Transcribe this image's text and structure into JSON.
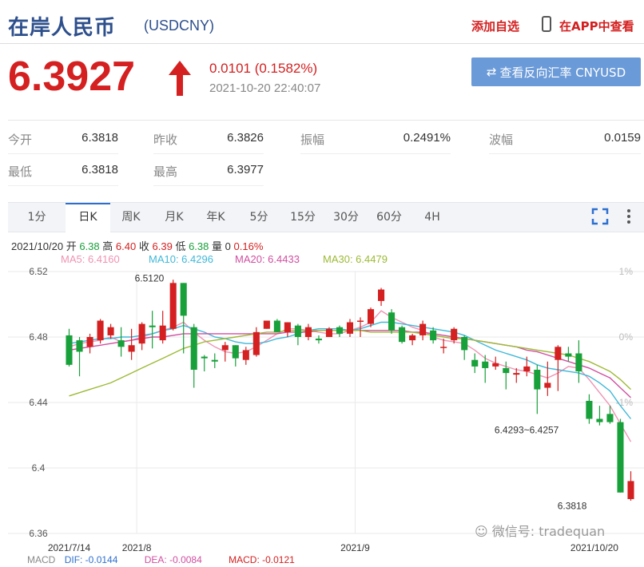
{
  "header": {
    "title": "在岸人民币",
    "code": "(USDCNY)",
    "add_watch": "添加自选",
    "app_view": "在APP中查看"
  },
  "quote": {
    "price": "6.3927",
    "change": "0.0101 (0.1582%)",
    "datetime": "2021-10-20 22:40:07",
    "reverse_button": "查看反向汇率 CNYUSD",
    "direction": "up",
    "up_color": "#d42020",
    "down_color": "#18a03a"
  },
  "stats": [
    {
      "label": "今开",
      "value": "6.3818"
    },
    {
      "label": "昨收",
      "value": "6.3826"
    },
    {
      "label": "振幅",
      "value": "0.2491%"
    },
    {
      "label": "波幅",
      "value": "0.0159"
    },
    {
      "label": "最低",
      "value": "6.3818"
    },
    {
      "label": "最高",
      "value": "6.3977"
    }
  ],
  "tabs": [
    "1分",
    "日K",
    "周K",
    "月K",
    "年K",
    "5分",
    "15分",
    "30分",
    "60分",
    "4H"
  ],
  "active_tab": "日K",
  "ohlc_line": {
    "date": "2021/10/20",
    "open_label": "开",
    "open": "6.38",
    "high_label": "高",
    "high": "6.40",
    "close_label": "收",
    "close": "6.39",
    "low_label": "低",
    "low": "6.38",
    "vol_label": "量",
    "vol": "0",
    "pct": "0.16%"
  },
  "ma_line": [
    {
      "text": "MA5: 6.4160",
      "color": "#ef93b4"
    },
    {
      "text": "MA10: 6.4296",
      "color": "#3fb8d8"
    },
    {
      "text": "MA20: 6.4433",
      "color": "#d04fa0"
    },
    {
      "text": "MA30: 6.4479",
      "color": "#9cba35"
    }
  ],
  "macd_line": [
    {
      "text": "MACD",
      "color": "#888888"
    },
    {
      "text": "DIF: -0.0144",
      "color": "#3070d0"
    },
    {
      "text": "DEA: -0.0084",
      "color": "#d04fa0"
    },
    {
      "text": "MACD: -0.0121",
      "color": "#d42020"
    }
  ],
  "watermarks": {
    "wechat": "微信号: tradequan"
  },
  "chart_data": {
    "type": "candlestick",
    "y_ticks": [
      "6.52",
      "6.48",
      "6.44",
      "6.4",
      "6.36"
    ],
    "y_tick_values": [
      6.52,
      6.48,
      6.44,
      6.4,
      6.36
    ],
    "pct_ticks": [
      "1%",
      "0%",
      "-1%"
    ],
    "ylim": [
      6.36,
      6.52
    ],
    "x_labels": [
      "2021/7/14",
      "2021/8",
      "2021/9",
      "2021/10/20"
    ],
    "x_label_index": [
      0,
      6.5,
      27.5,
      50.5
    ],
    "annotations": [
      {
        "text": "6.5120",
        "index": 6,
        "value": 6.512
      },
      {
        "text": "6.4293~6.4257",
        "index": 46,
        "value": 6.428
      },
      {
        "text": "6.3818",
        "index": 49,
        "value": 6.3818
      }
    ],
    "candles": [
      [
        6.481,
        6.463,
        6.485,
        6.462
      ],
      [
        6.478,
        6.471,
        6.48,
        6.456
      ],
      [
        6.474,
        6.48,
        6.482,
        6.47
      ],
      [
        6.478,
        6.49,
        6.491,
        6.476
      ],
      [
        6.481,
        6.486,
        6.488,
        6.479
      ],
      [
        6.478,
        6.474,
        6.486,
        6.468
      ],
      [
        6.471,
        6.475,
        6.485,
        6.466
      ],
      [
        6.476,
        6.488,
        6.489,
        6.472
      ],
      [
        6.487,
        6.486,
        6.496,
        6.473
      ],
      [
        6.478,
        6.487,
        6.496,
        6.476
      ],
      [
        6.485,
        6.513,
        6.515,
        6.484
      ],
      [
        6.513,
        6.493,
        6.513,
        6.47
      ],
      [
        6.486,
        6.46,
        6.488,
        6.449
      ],
      [
        6.468,
        6.467,
        6.469,
        6.459
      ],
      [
        6.466,
        6.465,
        6.47,
        6.461
      ],
      [
        6.472,
        6.475,
        6.477,
        6.465
      ],
      [
        6.475,
        6.467,
        6.475,
        6.462
      ],
      [
        6.466,
        6.472,
        6.474,
        6.463
      ],
      [
        6.469,
        6.483,
        6.486,
        6.468
      ],
      [
        6.485,
        6.49,
        6.49,
        6.485
      ],
      [
        6.49,
        6.483,
        6.491,
        6.483
      ],
      [
        6.483,
        6.489,
        6.489,
        6.48
      ],
      [
        6.487,
        6.48,
        6.488,
        6.475
      ],
      [
        6.48,
        6.486,
        6.488,
        6.478
      ],
      [
        6.479,
        6.478,
        6.481,
        6.476
      ],
      [
        6.48,
        6.485,
        6.486,
        6.48
      ],
      [
        6.486,
        6.482,
        6.487,
        6.48
      ],
      [
        6.482,
        6.489,
        6.491,
        6.48
      ],
      [
        6.49,
        6.49,
        6.492,
        6.48
      ],
      [
        6.488,
        6.497,
        6.498,
        6.486
      ],
      [
        6.502,
        6.509,
        6.51,
        6.499
      ],
      [
        6.495,
        6.484,
        6.497,
        6.482
      ],
      [
        6.486,
        6.477,
        6.487,
        6.476
      ],
      [
        6.478,
        6.481,
        6.482,
        6.475
      ],
      [
        6.481,
        6.488,
        6.49,
        6.478
      ],
      [
        6.484,
        6.478,
        6.486,
        6.476
      ],
      [
        6.474,
        6.474,
        6.479,
        6.47
      ],
      [
        6.478,
        6.485,
        6.486,
        6.476
      ],
      [
        6.48,
        6.472,
        6.481,
        6.466
      ],
      [
        6.466,
        6.462,
        6.47,
        6.458
      ],
      [
        6.465,
        6.461,
        6.469,
        6.452
      ],
      [
        6.462,
        6.464,
        6.468,
        6.46
      ],
      [
        6.461,
        6.458,
        6.465,
        6.448
      ],
      [
        6.457,
        6.458,
        6.461,
        6.452
      ],
      [
        6.459,
        6.462,
        6.468,
        6.456
      ],
      [
        6.46,
        6.448,
        6.463,
        6.433
      ],
      [
        6.449,
        6.452,
        6.465,
        6.444
      ],
      [
        6.466,
        6.474,
        6.475,
        6.447
      ],
      [
        6.47,
        6.468,
        6.474,
        6.465
      ],
      [
        6.47,
        6.459,
        6.478,
        6.452
      ],
      [
        6.441,
        6.43,
        6.445,
        6.427
      ],
      [
        6.43,
        6.428,
        6.438,
        6.426
      ],
      [
        6.433,
        6.428,
        6.438,
        6.427
      ],
      [
        6.428,
        6.385,
        6.43,
        6.385
      ],
      [
        6.381,
        6.392,
        6.398,
        6.38
      ]
    ],
    "candle_format": "[open, close, high, low]",
    "ma_series": [
      {
        "name": "MA5",
        "color": "#ef93b4",
        "values": [
          6.474,
          6.476,
          6.477,
          6.478,
          6.48,
          6.477,
          6.478,
          6.48,
          6.482,
          6.484,
          6.486,
          6.489,
          6.483,
          6.478,
          6.474,
          6.471,
          6.47,
          6.471,
          6.474,
          6.478,
          6.482,
          6.485,
          6.485,
          6.484,
          6.483,
          6.482,
          6.482,
          6.484,
          6.486,
          6.489,
          6.496,
          6.492,
          6.489,
          6.486,
          6.484,
          6.48,
          6.478,
          6.477,
          6.476,
          6.472,
          6.467,
          6.464,
          6.462,
          6.46,
          6.459,
          6.457,
          6.455,
          6.458,
          6.462,
          6.461,
          6.454,
          6.446,
          6.438,
          6.427,
          6.416
        ]
      },
      {
        "name": "MA10",
        "color": "#3fb8d8",
        "values": [
          6.476,
          6.477,
          6.478,
          6.479,
          6.479,
          6.48,
          6.48,
          6.481,
          6.482,
          6.484,
          6.485,
          6.487,
          6.485,
          6.483,
          6.48,
          6.479,
          6.477,
          6.476,
          6.476,
          6.477,
          6.479,
          6.48,
          6.482,
          6.484,
          6.485,
          6.485,
          6.485,
          6.484,
          6.485,
          6.487,
          6.489,
          6.489,
          6.488,
          6.487,
          6.486,
          6.485,
          6.484,
          6.483,
          6.481,
          6.478,
          6.475,
          6.472,
          6.47,
          6.468,
          6.466,
          6.463,
          6.461,
          6.46,
          6.459,
          6.458,
          6.456,
          6.452,
          6.447,
          6.438,
          6.43
        ]
      },
      {
        "name": "MA20",
        "color": "#d04fa0",
        "values": [
          6.472,
          6.473,
          6.474,
          6.475,
          6.476,
          6.477,
          6.478,
          6.479,
          6.48,
          6.48,
          6.481,
          6.482,
          6.482,
          6.482,
          6.482,
          6.482,
          6.482,
          6.482,
          6.482,
          6.482,
          6.482,
          6.483,
          6.483,
          6.483,
          6.484,
          6.484,
          6.484,
          6.484,
          6.484,
          6.484,
          6.484,
          6.484,
          6.484,
          6.483,
          6.483,
          6.482,
          6.481,
          6.48,
          6.479,
          6.478,
          6.477,
          6.476,
          6.475,
          6.474,
          6.472,
          6.471,
          6.469,
          6.467,
          6.465,
          6.463,
          6.461,
          6.458,
          6.455,
          6.449,
          6.443
        ]
      },
      {
        "name": "MA30",
        "color": "#9cba35",
        "values": [
          6.444,
          6.446,
          6.448,
          6.45,
          6.452,
          6.455,
          6.458,
          6.461,
          6.464,
          6.467,
          6.47,
          6.473,
          6.475,
          6.477,
          6.478,
          6.479,
          6.48,
          6.481,
          6.482,
          6.483,
          6.483,
          6.484,
          6.484,
          6.484,
          6.484,
          6.484,
          6.484,
          6.484,
          6.484,
          6.483,
          6.483,
          6.483,
          6.483,
          6.483,
          6.482,
          6.481,
          6.48,
          6.479,
          6.479,
          6.478,
          6.477,
          6.476,
          6.475,
          6.474,
          6.473,
          6.472,
          6.471,
          6.47,
          6.469,
          6.467,
          6.465,
          6.462,
          6.459,
          6.454,
          6.448
        ]
      }
    ]
  }
}
